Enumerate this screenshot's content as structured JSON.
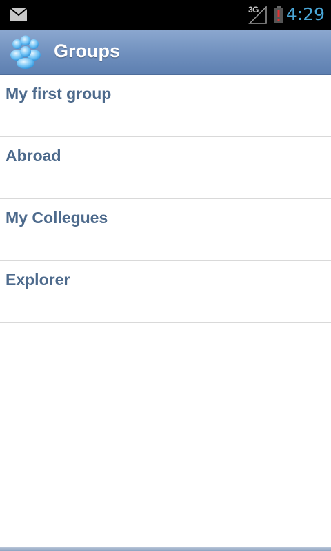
{
  "status_bar": {
    "network_type": "3G",
    "time": "4:29",
    "icons": [
      "mail-icon",
      "signal-icon",
      "battery-alert-icon"
    ],
    "clock_color": "#4aa7d8"
  },
  "header": {
    "title": "Groups",
    "icon": "group-icon",
    "background_color": "#6f8fbd"
  },
  "groups": [
    {
      "label": "My first group"
    },
    {
      "label": "Abroad"
    },
    {
      "label": "My Collegues"
    },
    {
      "label": "Explorer"
    }
  ],
  "colors": {
    "item_text": "#4d6a8c",
    "divider": "#d9d9d9"
  }
}
